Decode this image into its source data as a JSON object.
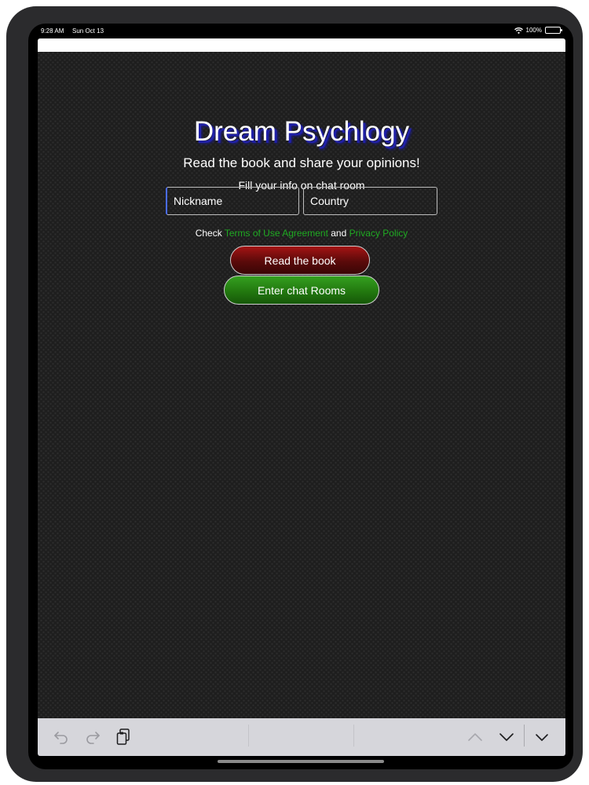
{
  "status": {
    "time": "9:28 AM",
    "date": "Sun Oct 13",
    "battery": "100%"
  },
  "page": {
    "title": "Dream Psychlogy",
    "subtitle": "Read the book and share your opinions!",
    "fill_info": "Fill your info on chat room",
    "nickname_placeholder": "Nickname",
    "country_placeholder": "Country",
    "check_prefix": "Check ",
    "terms_link": "Terms of Use Agreement",
    "check_and": " and ",
    "privacy_link": "Privacy Policy",
    "read_button": "Read the book",
    "chat_button": "Enter chat Rooms"
  },
  "colors": {
    "link": "#1faa22",
    "read_button": "#7a1010",
    "chat_button": "#2a8a18",
    "title_shadow": "#2020a8"
  },
  "toolbar": {
    "icons": [
      "undo-icon",
      "redo-icon",
      "paste-icon",
      "chevron-up-icon",
      "chevron-down-icon",
      "dismiss-keyboard-icon"
    ]
  }
}
